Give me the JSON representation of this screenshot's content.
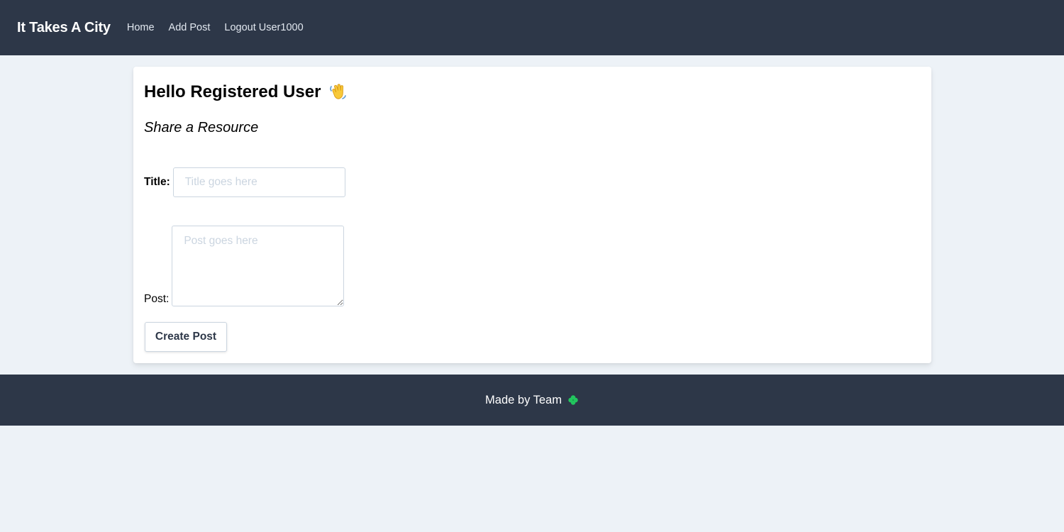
{
  "nav": {
    "brand": "It Takes A City",
    "links": [
      "Home",
      "Add Post",
      "Logout User1000"
    ]
  },
  "main": {
    "greeting": "Hello Registered User",
    "greeting_icon": "waving-hand-icon",
    "subtitle": "Share a Resource",
    "form": {
      "title_label": "Title:",
      "title_value": "",
      "title_placeholder": "Title goes here",
      "post_label": "Post:",
      "post_value": "",
      "post_placeholder": "Post goes here",
      "submit_label": "Create Post"
    }
  },
  "footer": {
    "text": "Made by Team",
    "icon": "four-leaf-clover-icon"
  },
  "colors": {
    "nav_bg": "#2d3748",
    "page_bg": "#edf2f7",
    "clover": "#22c55e",
    "placeholder": "#cbd5e0"
  }
}
